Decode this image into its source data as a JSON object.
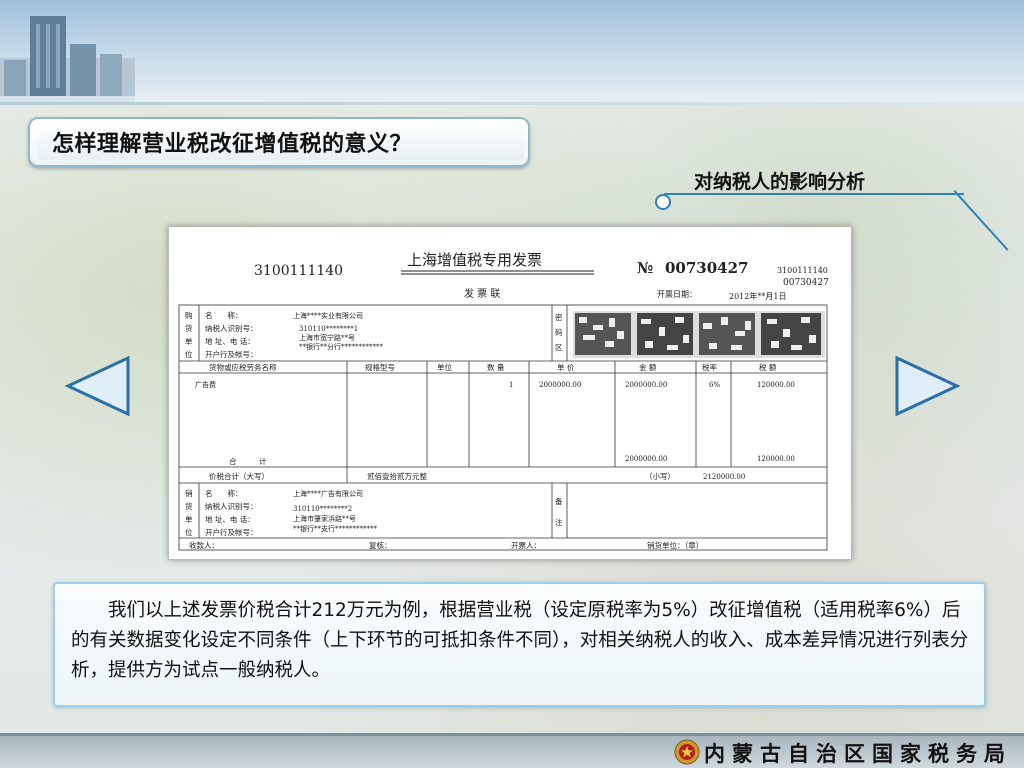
{
  "slide": {
    "title": "怎样理解营业税改征增值税的意义？",
    "subtitle": "对纳税人的影响分析",
    "body": "我们以上述发票价税合计212万元为例，根据营业税（设定原税率为5%）改征增值税（适用税率6%）后的有关数据变化设定不同条件（上下环节的可抵扣条件不同），对相关纳税人的收入、成本差异情况进行列表分析，提供方为试点一般纳税人。",
    "footer_org": "内蒙古自治区国家税务局"
  },
  "invoice": {
    "code_left": "3100111140",
    "heading": "上海增值税专用发票",
    "no_symbol": "№",
    "number": "00730427",
    "code_right": "3100111140",
    "number_right": "00730427",
    "copy_label": "发 票 联",
    "date_label": "开票日期：",
    "date_value": "2012年**月1日",
    "buyer_side": [
      "购",
      "货",
      "单",
      "位"
    ],
    "buyer_labels": [
      "名　　称：",
      "纳税人识别号：",
      "地 址、电 话：",
      "开户行及帐号："
    ],
    "buyer_values": [
      "上海****实业有限公司",
      "310110********1",
      "上海市宽宁路**号",
      "**银行**分行************"
    ],
    "cipher_side": [
      "密",
      "码",
      "区"
    ],
    "columns": [
      "货物或应税劳务名称",
      "规格型号",
      "单位",
      "数 量",
      "单 价",
      "金 额",
      "税率",
      "税 额"
    ],
    "item": {
      "name": "广告费",
      "quantity": "1",
      "unit_price": "2000000.00",
      "amount": "2000000.00",
      "rate": "6%",
      "tax": "120000.00"
    },
    "total_label": "合　　　计",
    "total_amount": "2000000.00",
    "total_tax": "120000.00",
    "grand_label": "价税合计（大写）",
    "grand_words": "贰佰壹拾贰万元整",
    "small_label": "（小写）",
    "grand_small": "2120000.00",
    "seller_side": [
      "销",
      "货",
      "单",
      "位"
    ],
    "seller_labels": [
      "名　　称：",
      "纳税人识别号：",
      "地 址、电 话：",
      "开户行及帐号："
    ],
    "seller_values": [
      "上海****广告有限公司",
      "310110********2",
      "上海市肇家浜路**号",
      "**银行**支行************"
    ],
    "note_side": [
      "备",
      "注"
    ],
    "sign_payee": "收款人：",
    "sign_review": "复核：",
    "sign_issuer": "开票人：",
    "sign_seller": "销货单位：（章）"
  },
  "icons": {
    "prev": "left-triangle-icon",
    "next": "right-triangle-icon",
    "emblem": "tax-emblem-icon"
  },
  "colors": {
    "accent": "#2d82b7",
    "nav_fill": "#dfeef8",
    "nav_stroke": "#2a6fa5",
    "body_border": "#9ccfe6"
  }
}
